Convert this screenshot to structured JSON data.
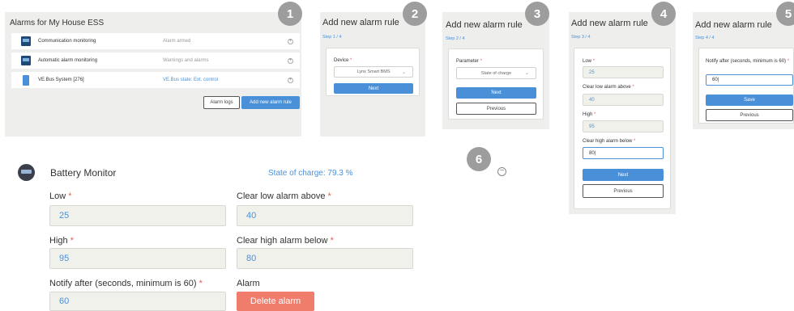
{
  "panel1": {
    "title": "Alarms for My House ESS",
    "rows": [
      {
        "name": "Communication monitoring",
        "status": "Alarm armed"
      },
      {
        "name": "Automatic alarm monitoring",
        "status": "Warnings and alarms"
      },
      {
        "name": "VE.Bus System [276]",
        "status": "VE.Bus state: Ext. control"
      }
    ],
    "alarm_logs_label": "Alarm logs",
    "add_rule_label": "Add new alarm rule",
    "plus_glyph": "+"
  },
  "badges": {
    "b1": "1",
    "b2": "2",
    "b3": "3",
    "b4": "4",
    "b5": "5",
    "b6": "6"
  },
  "step1": {
    "title": "Add new alarm rule",
    "step": "Step 1 / 4",
    "device_label": "Device",
    "device_value": "Lynx Smart BMS",
    "next_label": "Next"
  },
  "step2": {
    "title": "Add new alarm rule",
    "step": "Step 2 / 4",
    "parameter_label": "Parameter",
    "parameter_value": "State of charge",
    "next_label": "Next",
    "previous_label": "Previous"
  },
  "step3": {
    "title": "Add new alarm rule",
    "step": "Step 3 / 4",
    "low_label": "Low",
    "low_value": "25",
    "clear_low_label": "Clear low alarm above",
    "clear_low_value": "40",
    "high_label": "High",
    "high_value": "95",
    "clear_high_label": "Clear high alarm below",
    "clear_high_value": "80|",
    "next_label": "Next",
    "previous_label": "Previous"
  },
  "step4": {
    "title": "Add new alarm rule",
    "step": "Step 4 / 4",
    "notify_label": "Notify after (seconds, minimum is 60)",
    "notify_value": "60|",
    "save_label": "Save",
    "previous_label": "Previous"
  },
  "rule": {
    "name": "Battery Monitor",
    "status": "State of charge: 79.3 %",
    "low_label": "Low",
    "low_value": "25",
    "clear_low_label": "Clear low alarm above",
    "clear_low_value": "40",
    "high_label": "High",
    "high_value": "95",
    "clear_high_label": "Clear high alarm below",
    "clear_high_value": "80",
    "notify_label": "Notify after (seconds, minimum is 60)",
    "notify_value": "60",
    "alarm_label": "Alarm",
    "delete_label": "Delete alarm",
    "collapse_glyph": "−"
  },
  "required_mark": "*",
  "chevron_glyph": "⌄",
  "colors": {
    "accent": "#4a90d9",
    "required": "#e06050",
    "delete": "#f07c6c",
    "badge": "#9d9d9d"
  }
}
